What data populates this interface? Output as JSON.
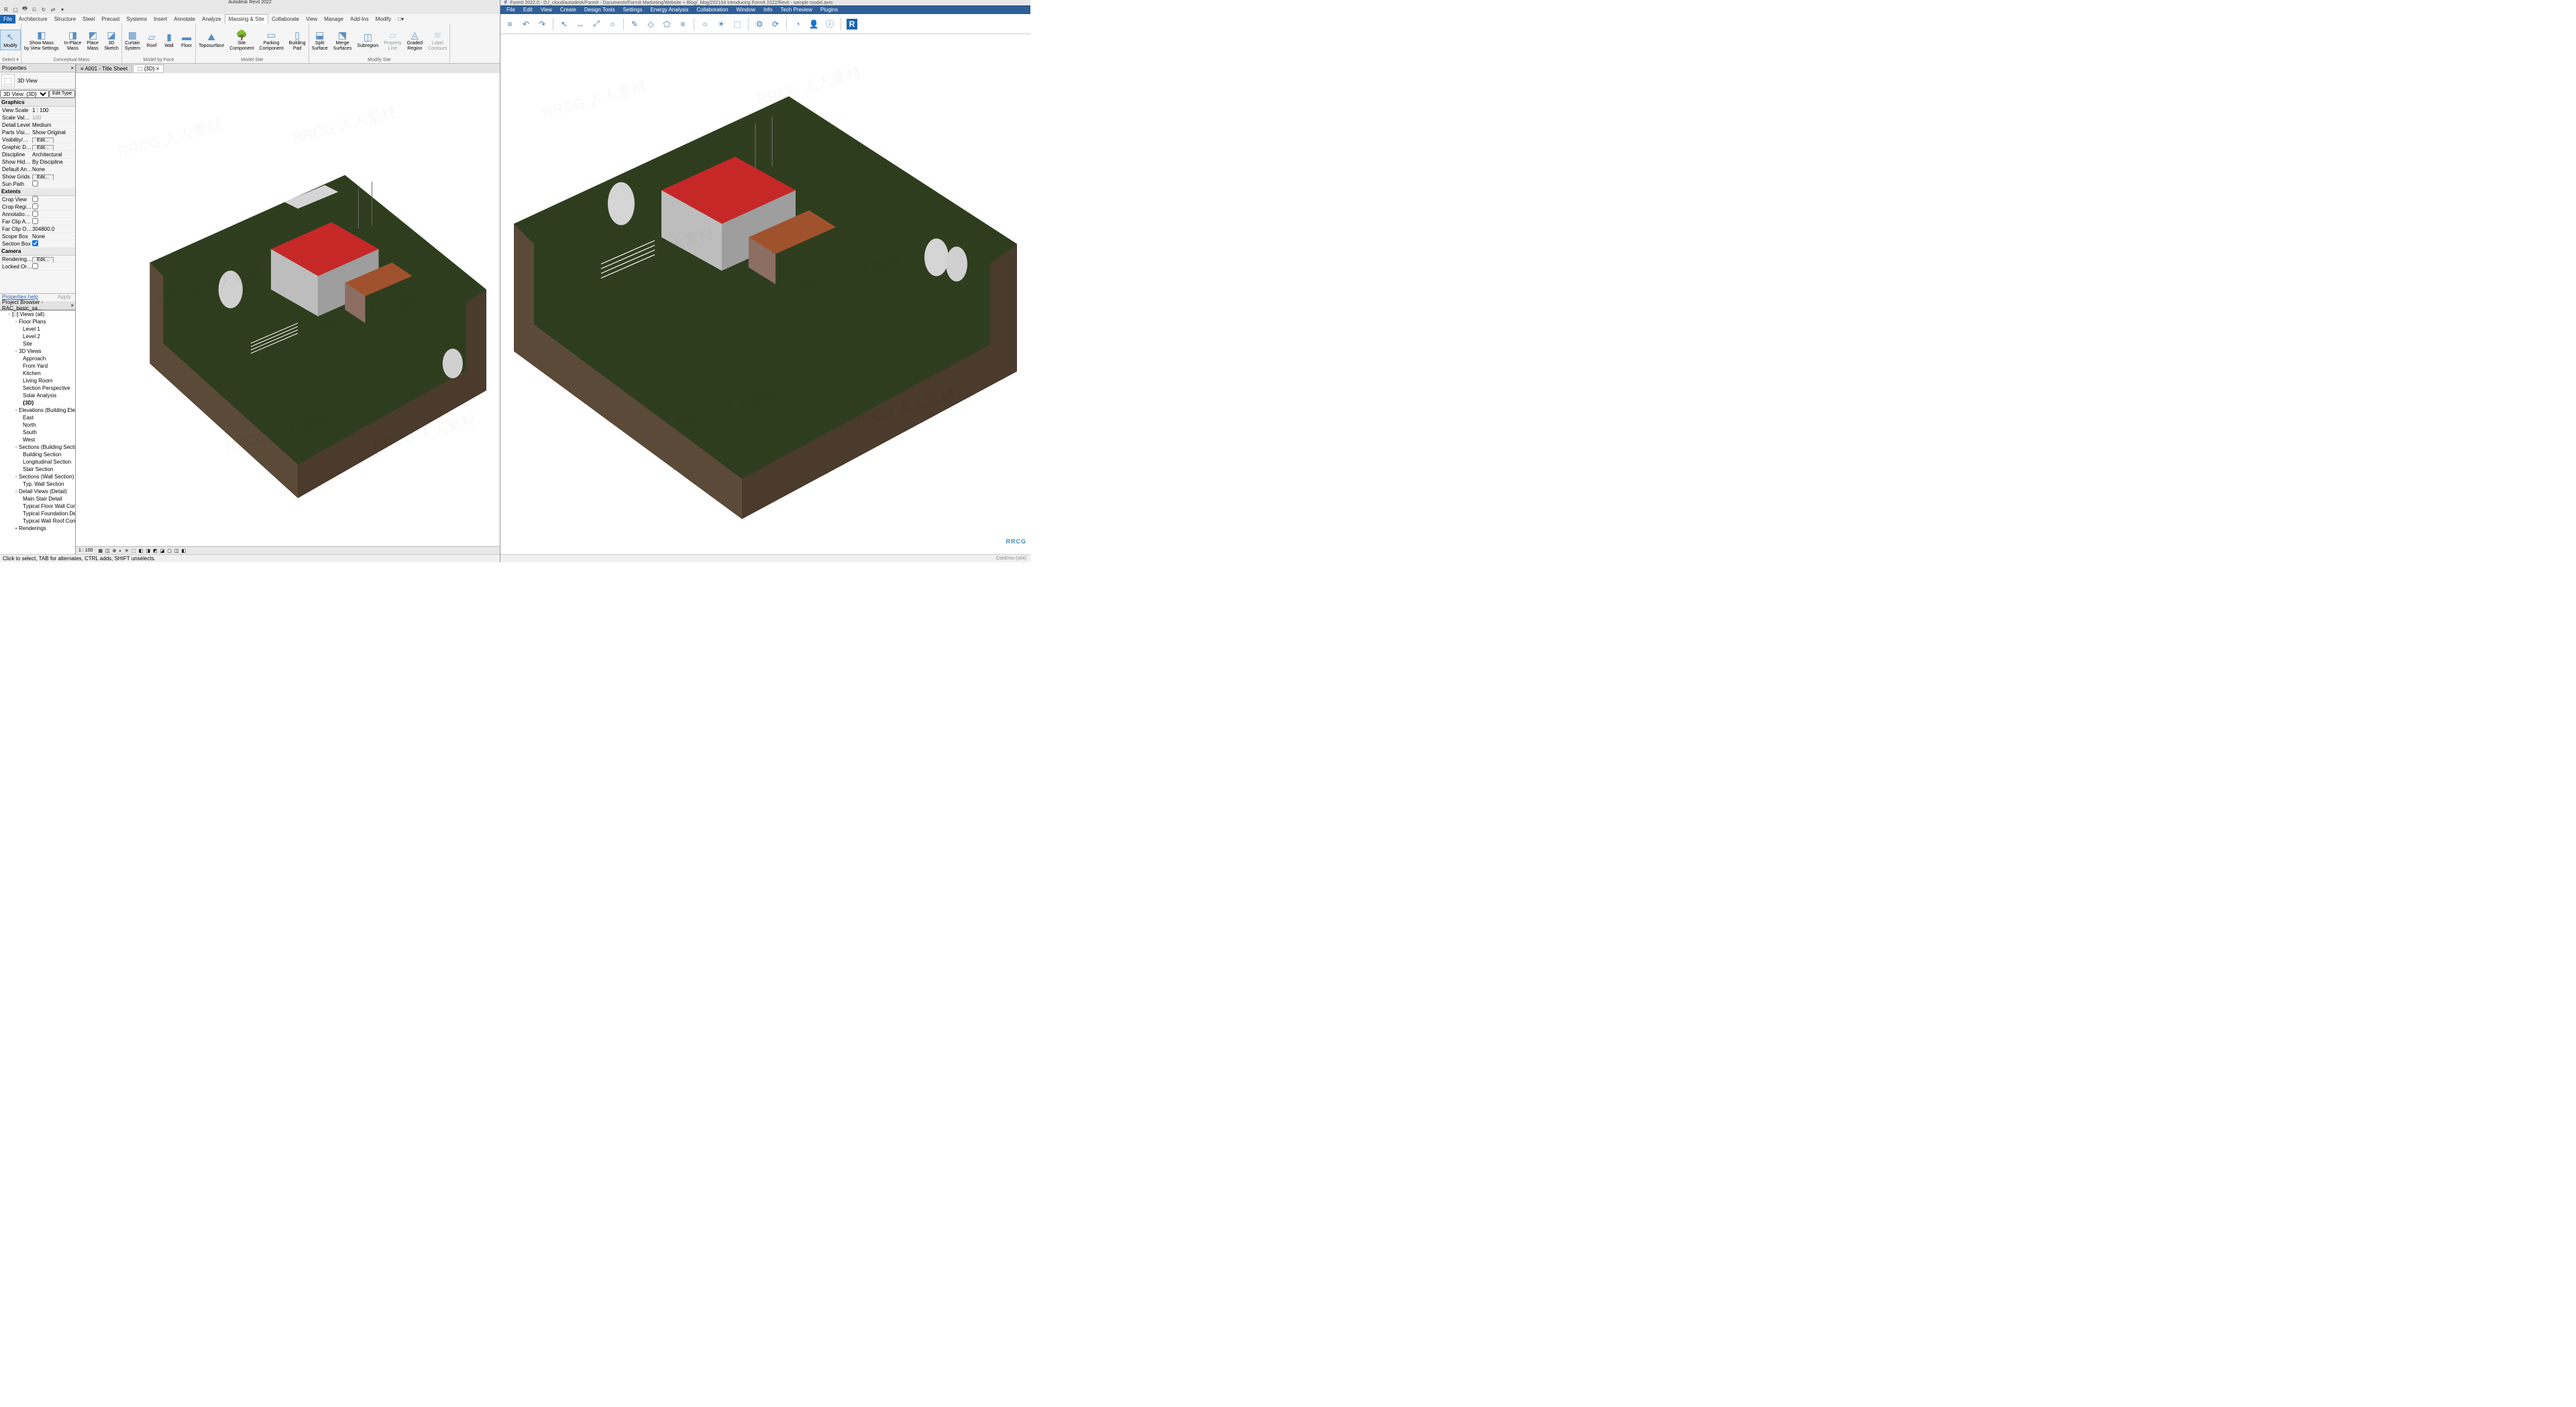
{
  "revit": {
    "title": "Autodesk Revit 2022",
    "qat_icons": [
      "R",
      "▢",
      "🖶",
      "⎌",
      "↻",
      "⇄",
      "▾"
    ],
    "tabs": [
      "File",
      "Architecture",
      "Structure",
      "Steel",
      "Precast",
      "Systems",
      "Insert",
      "Annotate",
      "Analyze",
      "Massing & Site",
      "Collaborate",
      "View",
      "Manage",
      "Add-Ins",
      "Modify",
      "□▾"
    ],
    "active_tab": "Massing & Site",
    "ribbon": {
      "modify": "Modify",
      "select": "Select ▾",
      "groups": [
        {
          "label": "Conceptual Mass",
          "btns": [
            {
              "name": "show-mass-by-view-settings",
              "icon": "◧",
              "label": "Show Mass\nby View Settings"
            },
            {
              "name": "inplace-mass",
              "icon": "◨",
              "label": "In-Place\nMass"
            },
            {
              "name": "place-mass",
              "icon": "◩",
              "label": "Place\nMass"
            },
            {
              "name": "3d-sketch",
              "icon": "◪",
              "label": "3D\nSketch"
            }
          ]
        },
        {
          "label": "Model by Face",
          "btns": [
            {
              "name": "curtain-system",
              "icon": "▦",
              "label": "Curtain\nSystem"
            },
            {
              "name": "roof",
              "icon": "▱",
              "label": "Roof"
            },
            {
              "name": "wall",
              "icon": "▮",
              "label": "Wall"
            },
            {
              "name": "floor",
              "icon": "▬",
              "label": "Floor"
            }
          ]
        },
        {
          "label": "Model Site",
          "btns": [
            {
              "name": "toposurface",
              "icon": "⛰",
              "label": "Toposurface"
            },
            {
              "name": "site-component",
              "icon": "🌳",
              "label": "Site\nComponent"
            },
            {
              "name": "parking-component",
              "icon": "▭",
              "label": "Parking\nComponent"
            },
            {
              "name": "building-pad",
              "icon": "▯",
              "label": "Building\nPad"
            }
          ]
        },
        {
          "label": "Modify Site",
          "btns": [
            {
              "name": "split-surface",
              "icon": "⬓",
              "label": "Split\nSurface"
            },
            {
              "name": "merge-surfaces",
              "icon": "⬔",
              "label": "Merge\nSurfaces"
            },
            {
              "name": "subregion",
              "icon": "◫",
              "label": "Subregion"
            },
            {
              "name": "property-line",
              "icon": "▱",
              "label": "Property\nLine",
              "disabled": true
            },
            {
              "name": "graded-region",
              "icon": "◬",
              "label": "Graded\nRegion"
            },
            {
              "name": "label-contours",
              "icon": "≋",
              "label": "Label\nContours",
              "disabled": true
            }
          ]
        }
      ]
    },
    "properties": {
      "title": "Properties",
      "type": "3D View",
      "selector": "3D View: {3D}",
      "edit_type": "Edit Type",
      "groups": [
        {
          "name": "Graphics",
          "rows": [
            {
              "k": "View Scale",
              "v": "1 : 100",
              "kind": "text"
            },
            {
              "k": "Scale Value ...",
              "v": "100",
              "kind": "gray"
            },
            {
              "k": "Detail Level",
              "v": "Medium",
              "kind": "text"
            },
            {
              "k": "Parts Visibility",
              "v": "Show Original",
              "kind": "text"
            },
            {
              "k": "Visibility/Gra...",
              "v": "Edit...",
              "kind": "btn"
            },
            {
              "k": "Graphic Dis...",
              "v": "Edit...",
              "kind": "btn"
            },
            {
              "k": "Discipline",
              "v": "Architectural",
              "kind": "text"
            },
            {
              "k": "Show Hidde...",
              "v": "By Discipline",
              "kind": "text"
            },
            {
              "k": "Default Anal...",
              "v": "None",
              "kind": "text"
            },
            {
              "k": "Show Grids",
              "v": "Edit...",
              "kind": "btn"
            },
            {
              "k": "Sun Path",
              "v": "",
              "kind": "check",
              "checked": false
            }
          ]
        },
        {
          "name": "Extents",
          "rows": [
            {
              "k": "Crop View",
              "v": "",
              "kind": "check",
              "checked": false
            },
            {
              "k": "Crop Regio...",
              "v": "",
              "kind": "check",
              "checked": false
            },
            {
              "k": "Annotation ...",
              "v": "",
              "kind": "check",
              "checked": false
            },
            {
              "k": "Far Clip Active",
              "v": "",
              "kind": "check",
              "checked": false
            },
            {
              "k": "Far Clip Offs...",
              "v": "304800.0",
              "kind": "text"
            },
            {
              "k": "Scope Box",
              "v": "None",
              "kind": "text"
            },
            {
              "k": "Section Box",
              "v": "",
              "kind": "check",
              "checked": true
            }
          ]
        },
        {
          "name": "Camera",
          "rows": [
            {
              "k": "Rendering S...",
              "v": "Edit...",
              "kind": "btn"
            },
            {
              "k": "Locked Orie...",
              "v": "",
              "kind": "check",
              "checked": false
            }
          ]
        }
      ],
      "help": "Properties help",
      "apply": "Apply"
    },
    "browser": {
      "title": "Project Browser - RAC_basic_sa...",
      "tree": [
        {
          "l": 0,
          "exp": "−",
          "label": "[□] Views (all)"
        },
        {
          "l": 1,
          "exp": "−",
          "label": "Floor Plans"
        },
        {
          "l": 2,
          "label": "Level 1"
        },
        {
          "l": 2,
          "label": "Level 2"
        },
        {
          "l": 2,
          "label": "Site"
        },
        {
          "l": 1,
          "exp": "−",
          "label": "3D Views"
        },
        {
          "l": 2,
          "label": "Approach"
        },
        {
          "l": 2,
          "label": "From Yard"
        },
        {
          "l": 2,
          "label": "Kitchen"
        },
        {
          "l": 2,
          "label": "Living Room"
        },
        {
          "l": 2,
          "label": "Section Perspective"
        },
        {
          "l": 2,
          "label": "Solar Analysis"
        },
        {
          "l": 2,
          "label": "{3D}",
          "bold": true
        },
        {
          "l": 1,
          "exp": "−",
          "label": "Elevations (Building Elevati"
        },
        {
          "l": 2,
          "label": "East"
        },
        {
          "l": 2,
          "label": "North"
        },
        {
          "l": 2,
          "label": "South"
        },
        {
          "l": 2,
          "label": "West"
        },
        {
          "l": 1,
          "exp": "−",
          "label": "Sections (Building Section"
        },
        {
          "l": 2,
          "label": "Building Section"
        },
        {
          "l": 2,
          "label": "Longitudinal Section"
        },
        {
          "l": 2,
          "label": "Stair Section"
        },
        {
          "l": 1,
          "exp": "−",
          "label": "Sections (Wall Section)"
        },
        {
          "l": 2,
          "label": "Typ. Wall Section"
        },
        {
          "l": 1,
          "exp": "−",
          "label": "Detail Views (Detail)"
        },
        {
          "l": 2,
          "label": "Main Stair Detail"
        },
        {
          "l": 2,
          "label": "Typical Floor Wall Con"
        },
        {
          "l": 2,
          "label": "Typical Foundation De"
        },
        {
          "l": 2,
          "label": "Typical Wall Roof Con"
        },
        {
          "l": 1,
          "exp": "+",
          "label": "Renderings"
        }
      ]
    },
    "viewtabs": [
      {
        "label": "A001 - Title Sheet",
        "icon": "≡"
      },
      {
        "label": "{3D}",
        "active": true,
        "icon": "⬚"
      }
    ],
    "viewbar": {
      "scale": "1 : 100",
      "icons": [
        "▦",
        "◫",
        "⊕",
        "◐",
        "☀",
        "⬚",
        "◧",
        "◨",
        "◩",
        "◪",
        "▢",
        "◫",
        "◧"
      ]
    },
    "footer": "Click to select, TAB for alternates, CTRL adds, SHIFT unselects."
  },
  "formit": {
    "title": "FormIt 2022.0 - D:/_cloud/autodesk/FormIt - Documents/FormIt Marketing/Website + Blog/_blog/202104 Introducing FormIt 2022/Revit - sample model.axm",
    "menus": [
      "File",
      "Edit",
      "View",
      "Create",
      "Design Tools",
      "Settings",
      "Energy Analysis",
      "Collaboration",
      "Window",
      "Info",
      "Tech Preview",
      "Plugins"
    ],
    "toolbar_icons": [
      "≡",
      "↶",
      "↷",
      "|",
      "↖",
      "↔",
      "⤢",
      "○",
      "|",
      "✎",
      "◇",
      "⬠",
      "≡",
      "|",
      "○",
      "☀",
      "⬚",
      "|",
      "⚙",
      "⟳",
      "|",
      "◔",
      "👤",
      "ⓘ",
      "|",
      "R"
    ],
    "status_right": "ConEmu (x64)"
  },
  "watermark_text": "RRCG 人人素材",
  "rrcg": "RRCG"
}
